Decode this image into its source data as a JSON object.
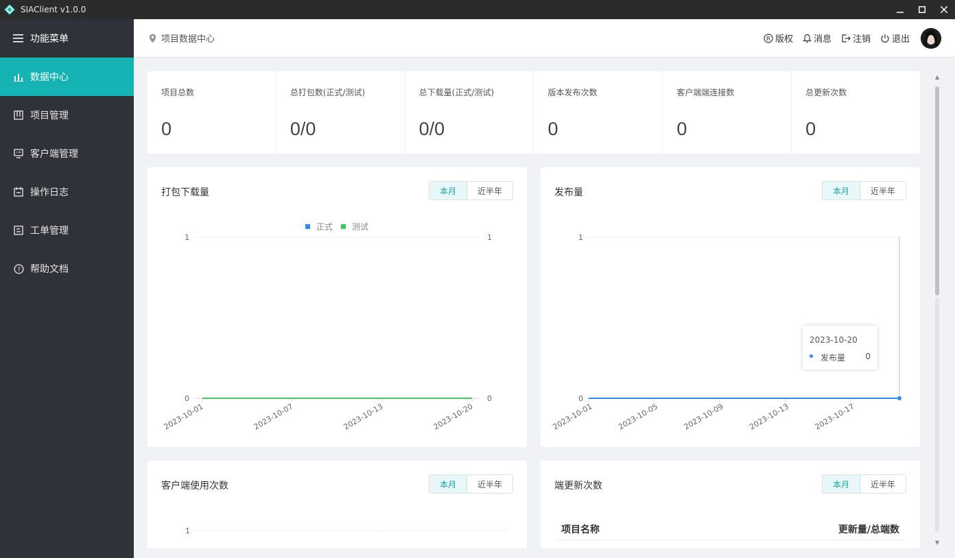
{
  "app": {
    "title": "SIAClient v1.0.0"
  },
  "sidebar": {
    "header": "功能菜单",
    "items": [
      {
        "label": "数据中心",
        "icon": "bar-chart-icon",
        "active": true
      },
      {
        "label": "项目管理",
        "icon": "project-icon"
      },
      {
        "label": "客户端管理",
        "icon": "monitor-icon"
      },
      {
        "label": "操作日志",
        "icon": "calendar-icon"
      },
      {
        "label": "工单管理",
        "icon": "ticket-icon"
      },
      {
        "label": "帮助文档",
        "icon": "help-icon"
      }
    ]
  },
  "header": {
    "breadcrumb": "项目数据中心",
    "links": {
      "copyright": "版权",
      "messages": "消息",
      "logout_session": "注销",
      "exit": "退出"
    }
  },
  "stats": [
    {
      "label": "项目总数",
      "value": "0"
    },
    {
      "label": "总打包数(正式/测试)",
      "value": "0/0"
    },
    {
      "label": "总下载量(正式/测试)",
      "value": "0/0"
    },
    {
      "label": "版本发布次数",
      "value": "0"
    },
    {
      "label": "客户端端连接数",
      "value": "0"
    },
    {
      "label": "总更新次数",
      "value": "0"
    }
  ],
  "toggle": {
    "month": "本月",
    "half_year": "近半年"
  },
  "cards": {
    "package_download": {
      "title": "打包下载量"
    },
    "release": {
      "title": "发布量"
    },
    "client_usage": {
      "title": "客户端使用次数"
    },
    "update_count": {
      "title": "端更新次数",
      "col_name": "项目名称",
      "col_value": "更新量/总端数"
    }
  },
  "tooltip": {
    "date": "2023-10-20",
    "name": "发布量",
    "value": "0"
  },
  "colors": {
    "accent": "#16b3b5",
    "formal": "#2d8cf0",
    "test": "#3ec95e",
    "sidebar": "#2f3238"
  },
  "chart_data": [
    {
      "type": "line",
      "title": "打包下载量",
      "x": [
        "2023-10-01",
        "2023-10-07",
        "2023-10-13",
        "2023-10-20"
      ],
      "series": [
        {
          "name": "正式",
          "values": [
            0,
            0,
            0,
            0
          ]
        },
        {
          "name": "测试",
          "values": [
            0,
            0,
            0,
            0
          ]
        }
      ],
      "ylim": [
        0,
        1
      ],
      "y_ticks_left": [
        "0",
        "1"
      ],
      "y_ticks_right": [
        "0",
        "1"
      ],
      "legend": "top-center"
    },
    {
      "type": "line",
      "title": "发布量",
      "x": [
        "2023-10-01",
        "2023-10-05",
        "2023-10-09",
        "2023-10-13",
        "2023-10-17"
      ],
      "series": [
        {
          "name": "发布量",
          "values": [
            0,
            0,
            0,
            0,
            0
          ]
        }
      ],
      "ylim": [
        0,
        1
      ],
      "y_ticks_left": [
        "0",
        "1"
      ]
    },
    {
      "type": "line",
      "title": "客户端使用次数",
      "y_ticks_left": [
        "1"
      ]
    }
  ]
}
